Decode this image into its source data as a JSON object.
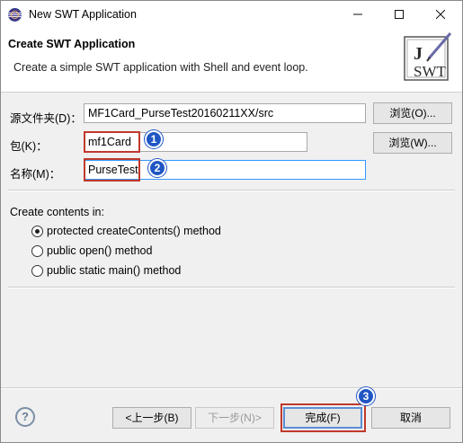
{
  "window": {
    "title": "New SWT Application",
    "icon": "eclipse-icon"
  },
  "banner": {
    "title": "Create SWT Application",
    "description": "Create a simple SWT application with Shell and event loop.",
    "logo_j": "J",
    "logo_swt": "SWT"
  },
  "form": {
    "source_folder_label": "源文件夹(D)：",
    "source_folder_value": "MF1Card_PurseTest20160211XX/src",
    "browse_source_label": "浏览(O)...",
    "package_label": "包(K)：",
    "package_value": "mf1Card",
    "browse_package_label": "浏览(W)...",
    "name_label": "名称(M)：",
    "name_value": "PurseTest"
  },
  "contents": {
    "heading": "Create contents in:",
    "options": [
      {
        "label": "protected createContents() method",
        "selected": true
      },
      {
        "label": "public open() method",
        "selected": false
      },
      {
        "label": "public static main() method",
        "selected": false
      }
    ]
  },
  "footer": {
    "help_glyph": "?",
    "back_label": "<上一步(B)",
    "next_label": "下一步(N)>",
    "finish_label": "完成(F)",
    "cancel_label": "取消"
  },
  "callouts": [
    "1",
    "2",
    "3"
  ],
  "colors": {
    "highlight_red": "#c0392b",
    "callout_blue": "#1f56c4",
    "focus_blue": "#3399ff"
  }
}
